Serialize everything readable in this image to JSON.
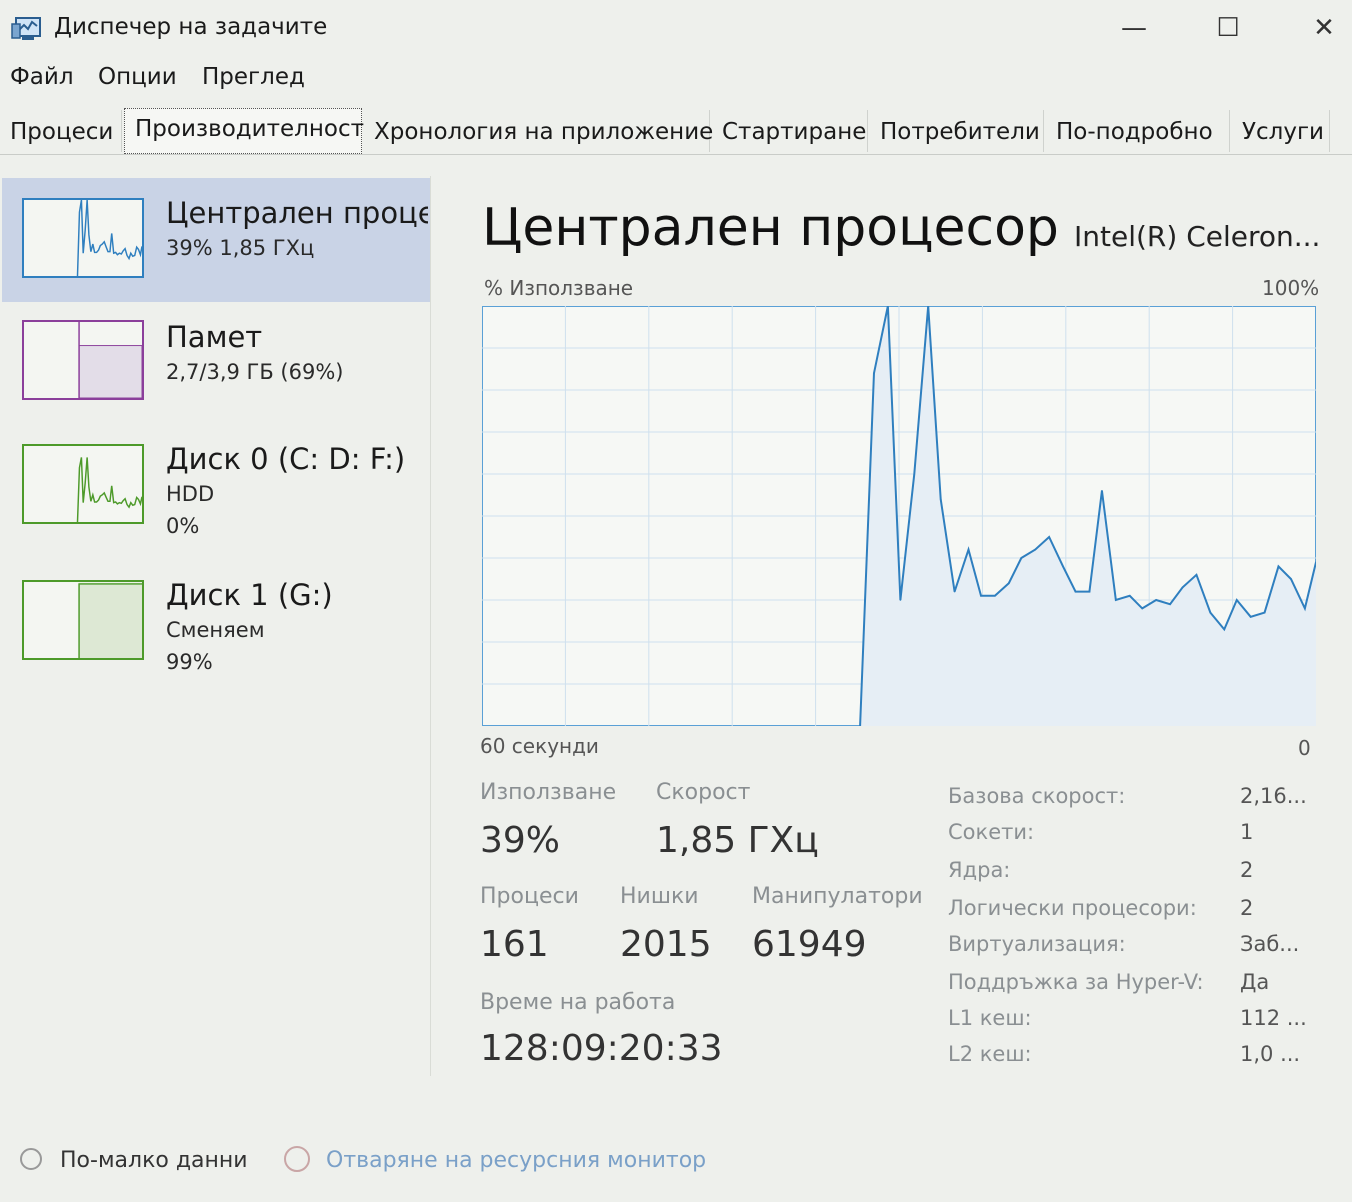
{
  "window": {
    "title": "Диспечер на задачите",
    "minimize": "—",
    "maximize": "☐",
    "close": "✕"
  },
  "menu": [
    "Файл",
    "Опции",
    "Преглед"
  ],
  "tabs": [
    "Процеси",
    "Производителност",
    "Хронология на приложение",
    "Стартиране",
    "Потребители",
    "По-подробно",
    "Услуги"
  ],
  "active_tab": "Производителност",
  "sidebar": {
    "items": [
      {
        "title": "Централен проце",
        "sub1": "39%  1,85 ГХц",
        "sub2": ""
      },
      {
        "title": "Памет",
        "sub1": "2,7/3,9 ГБ (69%)",
        "sub2": ""
      },
      {
        "title": "Диск 0 (C: D: F:)",
        "sub1": "HDD",
        "sub2": "0%"
      },
      {
        "title": "Диск 1 (G:)",
        "sub1": "Сменяем",
        "sub2": "99%"
      }
    ],
    "memory_usage_fraction": 0.69,
    "disk1_usage_fraction": 0.99
  },
  "main": {
    "title": "Централен процесор",
    "cpu_name": "Intel(R) Celeron...",
    "graph_label": "% Използване",
    "graph_max": "100%",
    "graph_time": "60 секунди",
    "graph_min": "0"
  },
  "colors": {
    "cpu": "#2f7fbf",
    "memory": "#8b3f9b",
    "disk": "#4d9a2a",
    "selected_bg": "#c9d3e6"
  },
  "chart_data": {
    "type": "line",
    "xlabel": "60 секунди",
    "ylabel": "% Използване",
    "ylim": [
      0,
      100
    ],
    "xlim": [
      60,
      0
    ],
    "grid": true,
    "series": [
      {
        "x": [
          32.8,
          31.8,
          30.8,
          29.9,
          28.9,
          27.9,
          27.0,
          26.0,
          25.0,
          24.1,
          23.1,
          22.1,
          21.2,
          20.2,
          19.2,
          18.2,
          17.3,
          16.3,
          15.4,
          14.4,
          13.4,
          12.5,
          11.5,
          10.5,
          9.6,
          8.6,
          7.6,
          6.6,
          5.7,
          4.7,
          3.7,
          2.7,
          1.8,
          0.8,
          0
        ],
        "y": [
          0,
          84,
          100,
          30,
          60,
          100,
          54,
          32,
          42,
          31,
          31,
          34,
          40,
          42,
          45,
          38,
          32,
          32,
          56,
          30,
          31,
          28,
          30,
          29,
          33,
          36,
          27,
          23,
          30,
          26,
          27,
          38,
          35,
          28,
          39
        ]
      }
    ]
  },
  "stats": {
    "usage_label": "Използване",
    "usage_value": "39%",
    "speed_label": "Скорост",
    "speed_value": "1,85 ГХц",
    "processes_label": "Процеси",
    "processes_value": "161",
    "threads_label": "Нишки",
    "threads_value": "2015",
    "handles_label": "Манипулатори",
    "handles_value": "61949",
    "uptime_label": "Време на работа",
    "uptime_value": "128:09:20:33"
  },
  "info": [
    {
      "label": "Базова скорост:",
      "value": "2,16..."
    },
    {
      "label": "Сокети:",
      "value": "1"
    },
    {
      "label": "Ядра:",
      "value": "2"
    },
    {
      "label": "Логически процесори:",
      "value": "2"
    },
    {
      "label": "Виртуализация:",
      "value": "Заб..."
    },
    {
      "label": "Поддръжка за Hyper-V:",
      "value": "Да"
    },
    {
      "label": "L1 кеш:",
      "value": "112 ..."
    },
    {
      "label": "L2 кеш:",
      "value": "1,0 ..."
    }
  ],
  "footer": {
    "less_details": "По-малко данни",
    "resource_monitor": "Отваряне на ресурсния монитор"
  }
}
